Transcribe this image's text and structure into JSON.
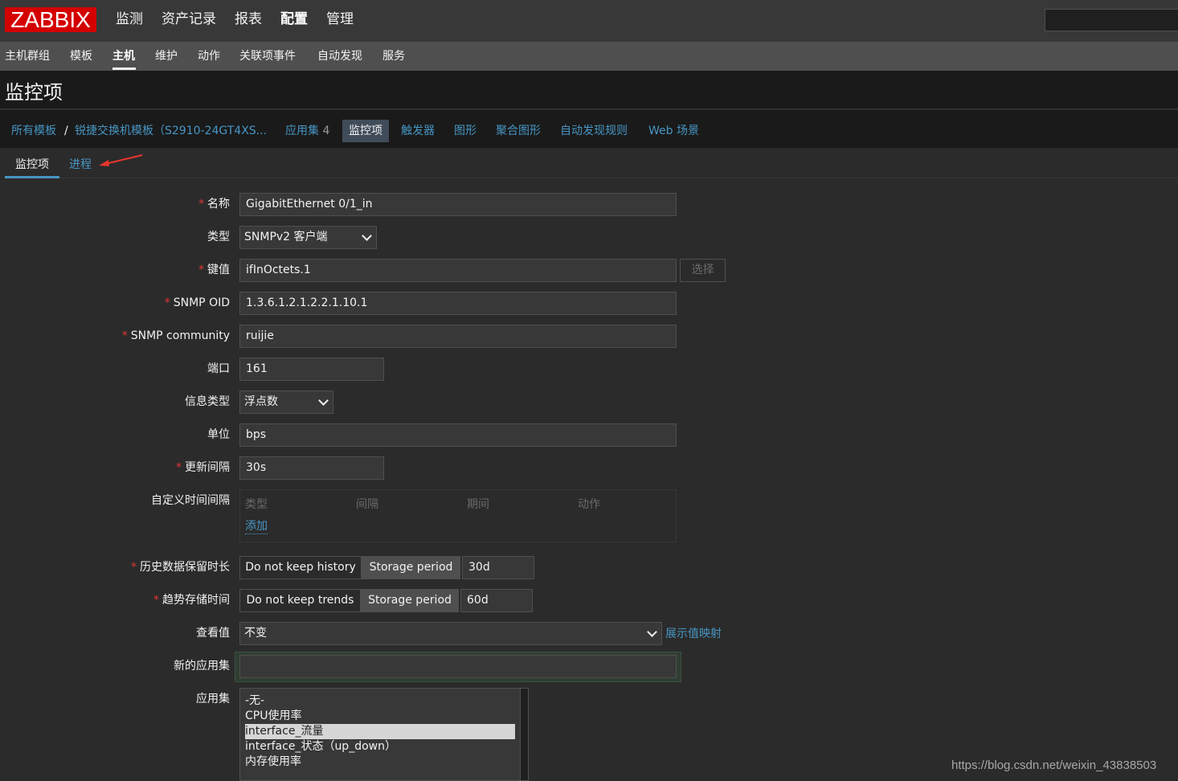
{
  "app": {
    "logo": "ZABBIX"
  },
  "main_menu": [
    "监测",
    "资产记录",
    "报表",
    "配置",
    "管理"
  ],
  "main_menu_active": "配置",
  "sub_menu": [
    "主机群组",
    "模板",
    "主机",
    "维护",
    "动作",
    "关联项事件",
    "自动发现",
    "服务"
  ],
  "sub_menu_active": "主机",
  "page_title": "监控项",
  "breadcrumb": {
    "all_templates": "所有模板",
    "separator": "/",
    "template": "锐捷交换机模板（S2910-24GT4XS...",
    "applications": "应用集",
    "applications_count": "4",
    "items": "监控项",
    "triggers": "触发器",
    "graphs": "图形",
    "screens": "聚合图形",
    "discovery": "自动发现规则",
    "web": "Web 场景"
  },
  "tabs": {
    "active": "监控项",
    "other": "进程"
  },
  "form": {
    "required_mark": "*",
    "name_label": "名称",
    "name_value": "GigabitEthernet 0/1_in",
    "type_label": "类型",
    "type_value": "SNMPv2 客户端",
    "key_label": "键值",
    "key_value": "ifInOctets.1",
    "select_button": "选择",
    "oid_label": "SNMP OID",
    "oid_value": "1.3.6.1.2.1.2.2.1.10.1",
    "community_label": "SNMP community",
    "community_value": "ruijie",
    "port_label": "端口",
    "port_value": "161",
    "info_type_label": "信息类型",
    "info_type_value": "浮点数",
    "units_label": "单位",
    "units_value": "bps",
    "delay_label": "更新间隔",
    "delay_value": "30s",
    "custom_intervals_label": "自定义时间间隔",
    "custom_intervals_headers": [
      "类型",
      "间隔",
      "期间",
      "动作"
    ],
    "custom_intervals_add": "添加",
    "history_label": "历史数据保留时长",
    "history_off": "Do not keep history",
    "history_on": "Storage period",
    "history_value": "30d",
    "trends_label": "趋势存储时间",
    "trends_off": "Do not keep trends",
    "trends_on": "Storage period",
    "trends_value": "60d",
    "valuemap_label": "查看值",
    "valuemap_value": "不变",
    "valuemap_link": "展示值映射",
    "new_app_label": "新的应用集",
    "new_app_value": "",
    "apps_label": "应用集",
    "apps": [
      "-无-",
      "CPU使用率",
      "interface_流量",
      "interface_状态（up_down）",
      "内存使用率"
    ],
    "apps_selected": "interface_流量"
  },
  "watermark": "https://blog.csdn.net/weixin_43838503"
}
